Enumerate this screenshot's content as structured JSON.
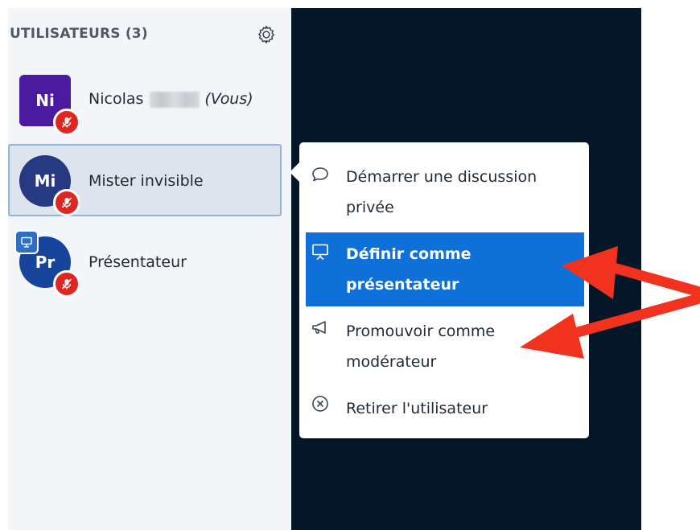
{
  "sidebar": {
    "title": "UTILISATEURS (3)",
    "settings_icon": "gear-icon",
    "users": [
      {
        "initials": "Ni",
        "name": "Nicolas",
        "you_label": "(Vous)",
        "avatar_color": "#4a1b9e",
        "shape": "square",
        "muted": true
      },
      {
        "initials": "Mi",
        "name": "Mister invisible",
        "avatar_color": "#253a80",
        "shape": "round",
        "muted": true,
        "selected": true
      },
      {
        "initials": "Pr",
        "name": "Présentateur",
        "avatar_color": "#19449c",
        "shape": "round",
        "muted": true,
        "presenter": true
      }
    ]
  },
  "context_menu": {
    "items": [
      {
        "icon": "chat-bubble-icon",
        "label": "Démarrer une discussion privée"
      },
      {
        "icon": "presentation-screen-icon",
        "label": "Définir comme présentateur",
        "active": true
      },
      {
        "icon": "megaphone-icon",
        "label": "Promouvoir comme modérateur"
      },
      {
        "icon": "circle-x-icon",
        "label": "Retirer l'utilisateur"
      }
    ]
  },
  "colors": {
    "sidebar_bg": "#f3f6f9",
    "main_bg": "#06172a",
    "accent": "#0f70d7",
    "mute_badge": "#df2721",
    "annotation_arrow": "#f0321e"
  }
}
